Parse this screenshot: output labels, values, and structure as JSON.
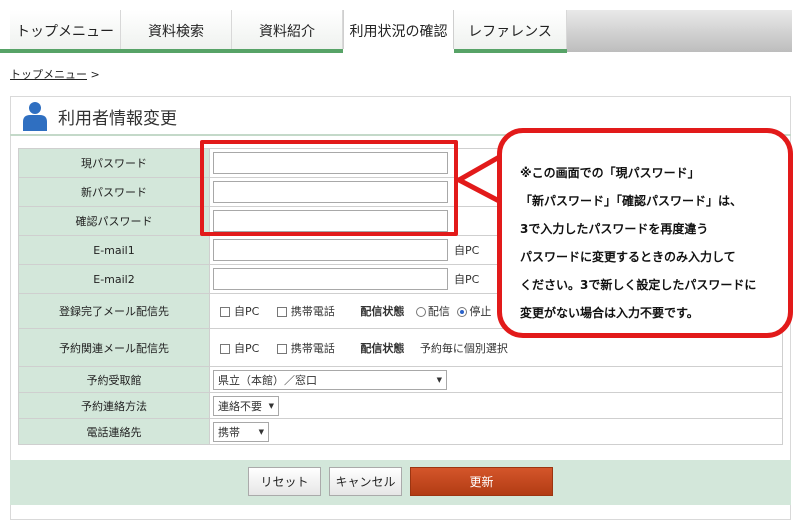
{
  "nav": {
    "tabs": [
      {
        "label": "トップメニュー"
      },
      {
        "label": "資料検索"
      },
      {
        "label": "資料紹介"
      },
      {
        "label": "利用状況の確認"
      },
      {
        "label": "レファレンス"
      }
    ]
  },
  "breadcrumb": {
    "link": "トップメニュー",
    "separator": ">"
  },
  "page_title": "利用者情報変更",
  "form": {
    "current_password_label": "現パスワード",
    "new_password_label": "新パスワード",
    "confirm_password_label": "確認パスワード",
    "email1_label": "E-mail1",
    "email1_suffix": "自PC",
    "email2_label": "E-mail2",
    "email2_suffix": "自PC",
    "reg_mail_label": "登録完了メール配信先",
    "reg_mail_pc": "自PC",
    "reg_mail_mobile": "携帯電話",
    "reg_mail_status_label": "配信状態",
    "reg_mail_status_on": "配信",
    "reg_mail_status_off": "停止",
    "rsv_mail_label": "予約関連メール配信先",
    "rsv_mail_pc": "自PC",
    "rsv_mail_mobile": "携帯電話",
    "rsv_mail_status_label": "配信状態",
    "rsv_mail_status_value": "予約毎に個別選択",
    "pickup_label": "予約受取館",
    "pickup_value": "県立（本館）／窓口",
    "contact_method_label": "予約連絡方法",
    "contact_method_value": "連絡不要",
    "phone_label": "電話連絡先",
    "phone_value": "携帯"
  },
  "buttons": {
    "reset": "リセット",
    "cancel": "キャンセル",
    "update": "更新"
  },
  "callout": {
    "lines": [
      "※この画面での「現パスワード」",
      "「新パスワード」「確認パスワード」は、",
      "3で入力したパスワードを再度違う",
      "パスワードに変更するときのみ入力して",
      "ください。3で新しく設定したパスワードに",
      "変更がない場合は入力不要です。"
    ]
  },
  "colors": {
    "accent_green": "#57a367",
    "label_bg": "#d3e7da",
    "highlight_red": "#e21a1a",
    "primary_button": "#c2461c"
  }
}
